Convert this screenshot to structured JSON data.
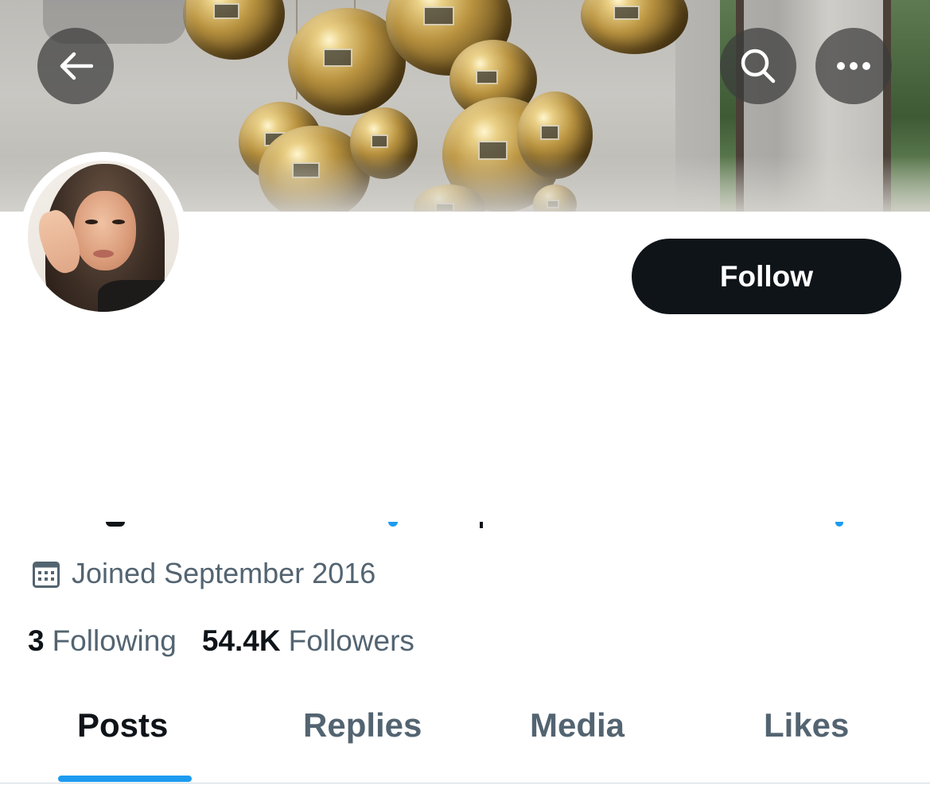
{
  "nav": {
    "back_icon": "arrow-left-icon",
    "search_icon": "search-icon",
    "more_icon": "more-horizontal-icon"
  },
  "profile": {
    "follow_label": "Follow",
    "joined_icon": "calendar-icon",
    "joined_text": "Joined September 2016",
    "following_count": "3",
    "following_label": "Following",
    "followers_count": "54.4K",
    "followers_label": "Followers"
  },
  "tabs": [
    {
      "label": "Posts",
      "active": true
    },
    {
      "label": "Replies",
      "active": false
    },
    {
      "label": "Media",
      "active": false
    },
    {
      "label": "Likes",
      "active": false
    }
  ],
  "colors": {
    "primary_text": "#0f1419",
    "secondary_text": "#536471",
    "accent": "#1d9bf0",
    "follow_button_bg": "#0f1419"
  }
}
